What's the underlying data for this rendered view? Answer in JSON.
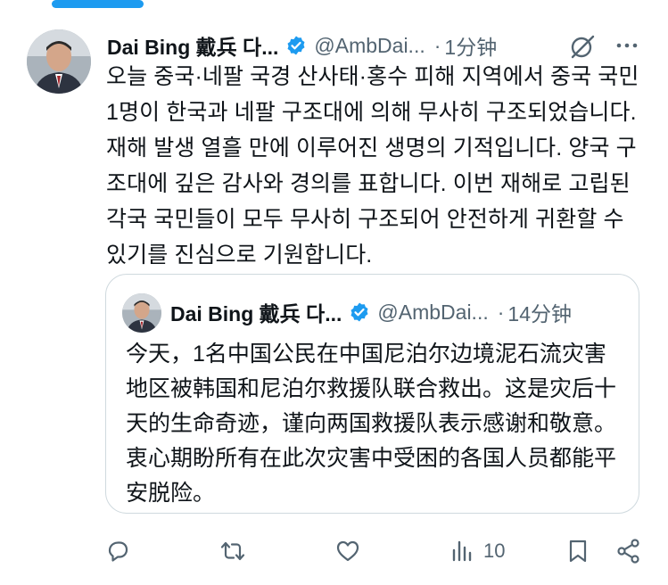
{
  "tweet": {
    "author_name": "Dai Bing 戴兵 다...",
    "handle": "@AmbDai...",
    "time": "1分钟",
    "separator": "·",
    "text": "오늘 중국·네팔 국경 산사태·홍수 피해 지역에서 중국 국민 1명이 한국과 네팔 구조대에 의해 무사히 구조되었습니다. 재해 발생 열흘 만에 이루어진 생명의 기적입니다. 양국 구조대에 깊은 감사와 경의를 표합니다. 이번 재해로 고립된 각국 국민들이 모두 무사히 구조되어 안전하게 귀환할 수 있기를 진심으로 기원합니다."
  },
  "quote": {
    "author_name": "Dai Bing 戴兵 다...",
    "handle": "@AmbDai...",
    "time": "14分钟",
    "separator": "·",
    "text": "今天，1名中国公民在中国尼泊尔边境泥石流灾害地区被韩国和尼泊尔救援队联合救出。这是灾后十天的生命奇迹，谨向两国救援队表示感谢和敬意。衷心期盼所有在此次灾害中受困的各国人员都能平安脱险。"
  },
  "actions": {
    "views_count": "10"
  },
  "icons": {
    "verified": "verified-badge-icon",
    "grok": "grok-icon",
    "more": "more-icon",
    "reply": "reply-icon",
    "retweet": "retweet-icon",
    "like": "like-icon",
    "views": "views-icon",
    "bookmark": "bookmark-icon",
    "share": "share-icon"
  },
  "colors": {
    "accent": "#1d9bf0",
    "text_primary": "#0f1419",
    "text_secondary": "#536471",
    "border": "#cfd9de"
  }
}
